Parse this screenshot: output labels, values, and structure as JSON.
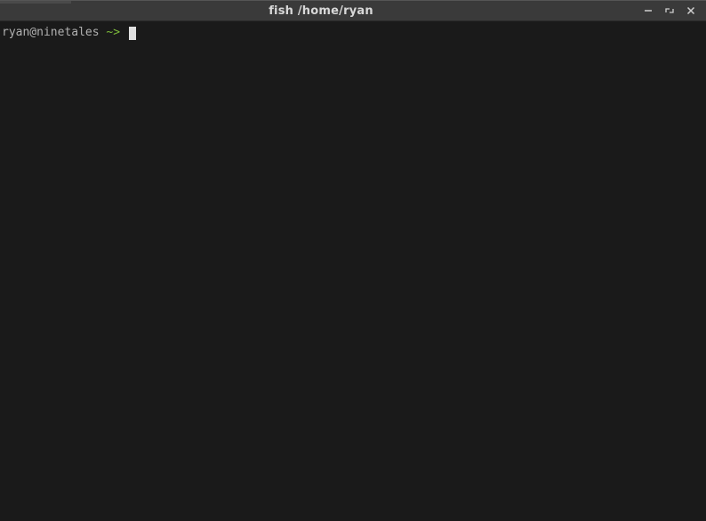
{
  "window": {
    "title": "fish  /home/ryan"
  },
  "terminal": {
    "prompt": {
      "user_host": "ryan@ninetales ",
      "path": "~",
      "symbol": "> "
    }
  }
}
